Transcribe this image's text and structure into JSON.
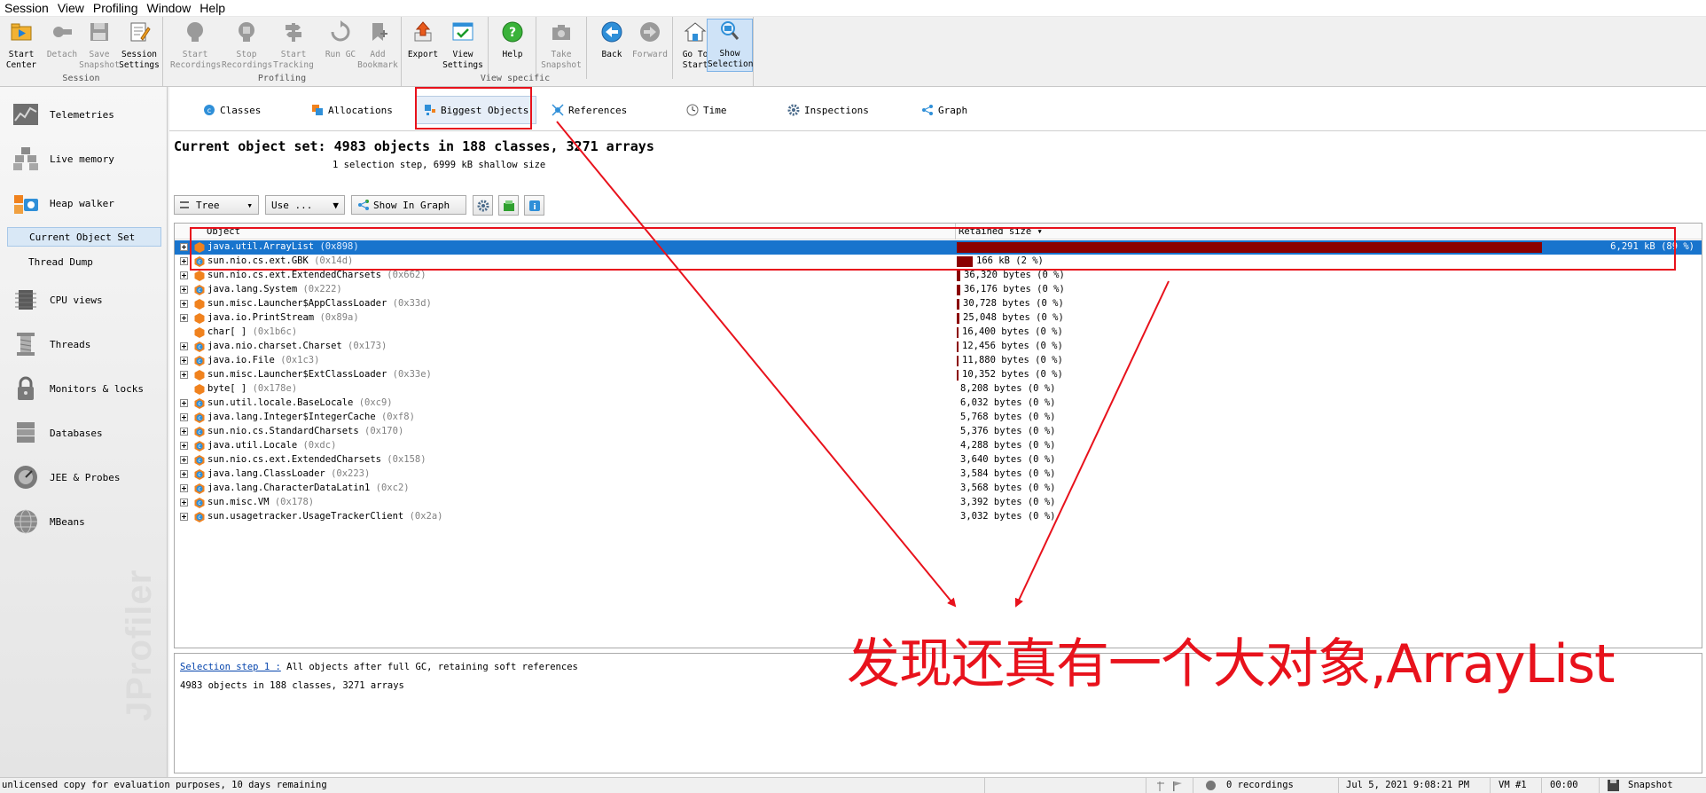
{
  "menu": [
    "Session",
    "View",
    "Profiling",
    "Window",
    "Help"
  ],
  "toolbar": {
    "groups": [
      "Session",
      "Profiling",
      "View specific"
    ],
    "buttons": {
      "start_center": [
        "Start",
        "Center"
      ],
      "detach": [
        "Detach",
        ""
      ],
      "save_snapshot": [
        "Save",
        "Snapshot"
      ],
      "session_settings": [
        "Session",
        "Settings"
      ],
      "start_recordings": [
        "Start",
        "Recordings"
      ],
      "stop_recordings": [
        "Stop",
        "Recordings"
      ],
      "start_tracking": [
        "Start",
        "Tracking"
      ],
      "run_gc": [
        "Run GC",
        ""
      ],
      "add_bookmark": [
        "Add",
        "Bookmark"
      ],
      "export": [
        "Export",
        ""
      ],
      "view_settings": [
        "View",
        "Settings"
      ],
      "help": [
        "Help",
        ""
      ],
      "take_snapshot": [
        "Take",
        "Snapshot"
      ],
      "back": [
        "Back",
        ""
      ],
      "forward": [
        "Forward",
        ""
      ],
      "go_to_start": [
        "Go To",
        "Start"
      ],
      "show_selection": [
        "Show",
        "Selection"
      ]
    }
  },
  "sidebar": {
    "items": [
      {
        "label": "Telemetries",
        "icon": "telemetries-icon"
      },
      {
        "label": "Live memory",
        "icon": "live-memory-icon"
      },
      {
        "label": "Heap walker",
        "icon": "heap-walker-icon"
      },
      {
        "label": "CPU views",
        "icon": "cpu-views-icon"
      },
      {
        "label": "Threads",
        "icon": "threads-icon"
      },
      {
        "label": "Monitors & locks",
        "icon": "monitors-locks-icon"
      },
      {
        "label": "Databases",
        "icon": "databases-icon"
      },
      {
        "label": "JEE & Probes",
        "icon": "jee-probes-icon"
      },
      {
        "label": "MBeans",
        "icon": "mbeans-icon"
      }
    ],
    "subitems": [
      "Current Object Set",
      "Thread Dump"
    ],
    "watermark": "JProfiler"
  },
  "tabs": [
    "Classes",
    "Allocations",
    "Biggest Objects",
    "References",
    "Time",
    "Inspections",
    "Graph"
  ],
  "active_tab": "Biggest Objects",
  "header": {
    "title": "Current object set: 4983 objects in 188 classes, 3271 arrays",
    "subtitle": "1 selection step, 6999 kB shallow size"
  },
  "view_toolbar": {
    "view_mode": "Tree",
    "use_menu": "Use ...",
    "show_in_graph": "Show In Graph"
  },
  "table": {
    "columns": [
      "Object",
      "Retained size ▾"
    ],
    "rows": [
      {
        "name": "java.util.ArrayList",
        "addr": "(0x898)",
        "size": "6,291 kB (89 %)",
        "pct": 89,
        "kind": "object",
        "selected": true,
        "expandable": true
      },
      {
        "name": "sun.nio.cs.ext.GBK",
        "addr": "(0x14d)",
        "size": "166 kB (2 %)",
        "pct": 2.4,
        "kind": "class",
        "selected": false,
        "expandable": true
      },
      {
        "name": "sun.nio.cs.ext.ExtendedCharsets",
        "addr": "(0x662)",
        "size": "36,320 bytes (0 %)",
        "pct": 0.52,
        "kind": "object",
        "selected": false,
        "expandable": true
      },
      {
        "name": "java.lang.System",
        "addr": "(0x222)",
        "size": "36,176 bytes (0 %)",
        "pct": 0.52,
        "kind": "class",
        "selected": false,
        "expandable": true
      },
      {
        "name": "sun.misc.Launcher$AppClassLoader",
        "addr": "(0x33d)",
        "size": "30,728 bytes (0 %)",
        "pct": 0.44,
        "kind": "object",
        "selected": false,
        "expandable": true
      },
      {
        "name": "java.io.PrintStream",
        "addr": "(0x89a)",
        "size": "25,048 bytes (0 %)",
        "pct": 0.36,
        "kind": "object",
        "selected": false,
        "expandable": true
      },
      {
        "name": "char[ ]",
        "addr": "(0x1b6c)",
        "size": "16,400 bytes (0 %)",
        "pct": 0.23,
        "kind": "object",
        "selected": false,
        "expandable": false
      },
      {
        "name": "java.nio.charset.Charset",
        "addr": "(0x173)",
        "size": "12,456 bytes (0 %)",
        "pct": 0.18,
        "kind": "class",
        "selected": false,
        "expandable": true
      },
      {
        "name": "java.io.File",
        "addr": "(0x1c3)",
        "size": "11,880 bytes (0 %)",
        "pct": 0.17,
        "kind": "class",
        "selected": false,
        "expandable": true
      },
      {
        "name": "sun.misc.Launcher$ExtClassLoader",
        "addr": "(0x33e)",
        "size": "10,352 bytes (0 %)",
        "pct": 0.15,
        "kind": "object",
        "selected": false,
        "expandable": true
      },
      {
        "name": "byte[ ]",
        "addr": "(0x178e)",
        "size": "8,208 bytes (0 %)",
        "pct": 0.0,
        "kind": "object",
        "selected": false,
        "expandable": false
      },
      {
        "name": "sun.util.locale.BaseLocale",
        "addr": "(0xc9)",
        "size": "6,032 bytes (0 %)",
        "pct": 0.0,
        "kind": "class",
        "selected": false,
        "expandable": true
      },
      {
        "name": "java.lang.Integer$IntegerCache",
        "addr": "(0xf8)",
        "size": "5,768 bytes (0 %)",
        "pct": 0.0,
        "kind": "class",
        "selected": false,
        "expandable": true
      },
      {
        "name": "sun.nio.cs.StandardCharsets",
        "addr": "(0x170)",
        "size": "5,376 bytes (0 %)",
        "pct": 0.0,
        "kind": "class",
        "selected": false,
        "expandable": true
      },
      {
        "name": "java.util.Locale",
        "addr": "(0xdc)",
        "size": "4,288 bytes (0 %)",
        "pct": 0.0,
        "kind": "class",
        "selected": false,
        "expandable": true
      },
      {
        "name": "sun.nio.cs.ext.ExtendedCharsets",
        "addr": "(0x158)",
        "size": "3,640 bytes (0 %)",
        "pct": 0.0,
        "kind": "class",
        "selected": false,
        "expandable": true
      },
      {
        "name": "java.lang.ClassLoader",
        "addr": "(0x223)",
        "size": "3,584 bytes (0 %)",
        "pct": 0.0,
        "kind": "class",
        "selected": false,
        "expandable": true
      },
      {
        "name": "java.lang.CharacterDataLatin1",
        "addr": "(0xc2)",
        "size": "3,568 bytes (0 %)",
        "pct": 0.0,
        "kind": "class",
        "selected": false,
        "expandable": true
      },
      {
        "name": "sun.misc.VM",
        "addr": "(0x178)",
        "size": "3,392 bytes (0 %)",
        "pct": 0.0,
        "kind": "class",
        "selected": false,
        "expandable": true
      },
      {
        "name": "sun.usagetracker.UsageTrackerClient",
        "addr": "(0x2a)",
        "size": "3,032 bytes (0 %)",
        "pct": 0.0,
        "kind": "class",
        "selected": false,
        "expandable": true
      }
    ]
  },
  "selection_panel": {
    "step_link": "Selection step 1 :",
    "step_text": " All objects after full GC, retaining soft references",
    "summary": "4983 objects in 188 classes, 3271 arrays"
  },
  "annotation": "发现还真有一个大对象,ArrayList",
  "statusbar": {
    "license": "unlicensed copy for evaluation purposes, 10 days remaining",
    "recordings": "0 recordings",
    "datetime": "Jul 5, 2021 9:08:21 PM",
    "vm": "VM #1",
    "elapsed": "00:00",
    "mode": "Snapshot"
  },
  "colors": {
    "selection": "#1874cd",
    "bar": "#8b0000",
    "annotation_red": "#e8121c",
    "object_icon": "#f0821e",
    "class_icon": "#2f8fd8"
  }
}
